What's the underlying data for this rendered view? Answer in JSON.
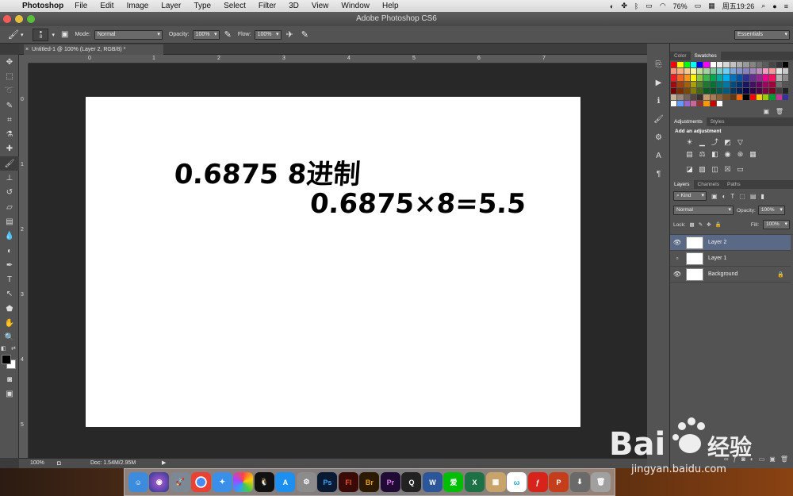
{
  "menubar": {
    "app": "Photoshop",
    "items": [
      "File",
      "Edit",
      "Image",
      "Layer",
      "Type",
      "Select",
      "Filter",
      "3D",
      "View",
      "Window",
      "Help"
    ],
    "battery": "76%",
    "clock": "周五19:26"
  },
  "window": {
    "title": "Adobe Photoshop CS6"
  },
  "options": {
    "brush_size": "8",
    "mode_label": "Mode:",
    "mode_value": "Normal",
    "opacity_label": "Opacity:",
    "opacity_value": "100%",
    "flow_label": "Flow:",
    "flow_value": "100%",
    "workspace": "Essentials"
  },
  "document": {
    "tab_title": "Untitled-1 @ 100% (Layer 2, RGB/8) *",
    "handwriting_line1": "0.6875 8进制",
    "handwriting_line2": "0.6875×8=5.5"
  },
  "rulers": {
    "h_ticks": [
      "0",
      "1",
      "2",
      "3",
      "4",
      "5",
      "6",
      "7"
    ],
    "v_ticks": [
      "0",
      "1",
      "2",
      "3",
      "4",
      "5"
    ]
  },
  "status": {
    "zoom": "100%",
    "doc": "Doc: 1.54M/2.95M"
  },
  "panels": {
    "color_tabs": [
      "Color",
      "Swatches"
    ],
    "adj_tabs": [
      "Adjustments",
      "Styles"
    ],
    "add_adjustment": "Add an adjustment",
    "layer_tabs": [
      "Layers",
      "Channels",
      "Paths"
    ],
    "kind_filter": "Kind",
    "blend_mode": "Normal",
    "opacity_label": "Opacity:",
    "opacity_value": "100%",
    "lock_label": "Lock:",
    "fill_label": "Fill:",
    "fill_value": "100%",
    "layers": [
      {
        "name": "Layer 2",
        "visible": true,
        "selected": true
      },
      {
        "name": "Layer 1",
        "visible": false,
        "selected": false
      },
      {
        "name": "Background",
        "visible": true,
        "selected": false,
        "locked": true
      }
    ]
  },
  "swatch_colors": [
    "#ff0000",
    "#ffff00",
    "#00ff00",
    "#00ffff",
    "#0000ff",
    "#ff00ff",
    "#ffffff",
    "#ebebeb",
    "#d6d6d6",
    "#c2c2c2",
    "#adadad",
    "#999999",
    "#858585",
    "#707070",
    "#5c5c5c",
    "#474747",
    "#333333",
    "#000000",
    "#f7977a",
    "#fbad82",
    "#fdc68c",
    "#fff799",
    "#c4df9b",
    "#a3d39c",
    "#82ca9c",
    "#7bcdc8",
    "#6ecff6",
    "#7ea7d8",
    "#8493ca",
    "#8882be",
    "#a187be",
    "#bc8dbf",
    "#f49bc1",
    "#f5989d",
    "#e5e5e5",
    "#c9c9c9",
    "#ed1c24",
    "#f26522",
    "#f7941d",
    "#fff200",
    "#8dc63f",
    "#39b54a",
    "#00a651",
    "#00a99d",
    "#00aeef",
    "#0072bc",
    "#0054a6",
    "#2e3192",
    "#662d91",
    "#92278f",
    "#ec008c",
    "#ed145b",
    "#b3b3b3",
    "#8c8c8c",
    "#9e0b0f",
    "#a0410d",
    "#a36209",
    "#aba000",
    "#598527",
    "#1a7b30",
    "#007236",
    "#00746b",
    "#0076a3",
    "#004b80",
    "#003471",
    "#1b1464",
    "#440e62",
    "#630460",
    "#9e005d",
    "#9e0039",
    "#707070",
    "#555555",
    "#790000",
    "#7b2e00",
    "#7d4900",
    "#827b00",
    "#406618",
    "#005e20",
    "#005826",
    "#005952",
    "#005b7f",
    "#003663",
    "#002157",
    "#0d004c",
    "#32004b",
    "#4b0049",
    "#7b0046",
    "#7a0026",
    "#404040",
    "#222222",
    "#c7b299",
    "#998675",
    "#736357",
    "#534741",
    "#37302d",
    "#c69c6d",
    "#a67c52",
    "#8c6239",
    "#754c24",
    "#603913",
    "#ff6600",
    "#000000",
    "#ff0000",
    "#ffcc00",
    "#99cc00",
    "#009933",
    "#cc3399",
    "#333399",
    "#ffffff",
    "#6699ff",
    "#9966cc",
    "#cc6699",
    "#993333",
    "#ff9900",
    "#cc0000",
    "#ffffff"
  ]
}
